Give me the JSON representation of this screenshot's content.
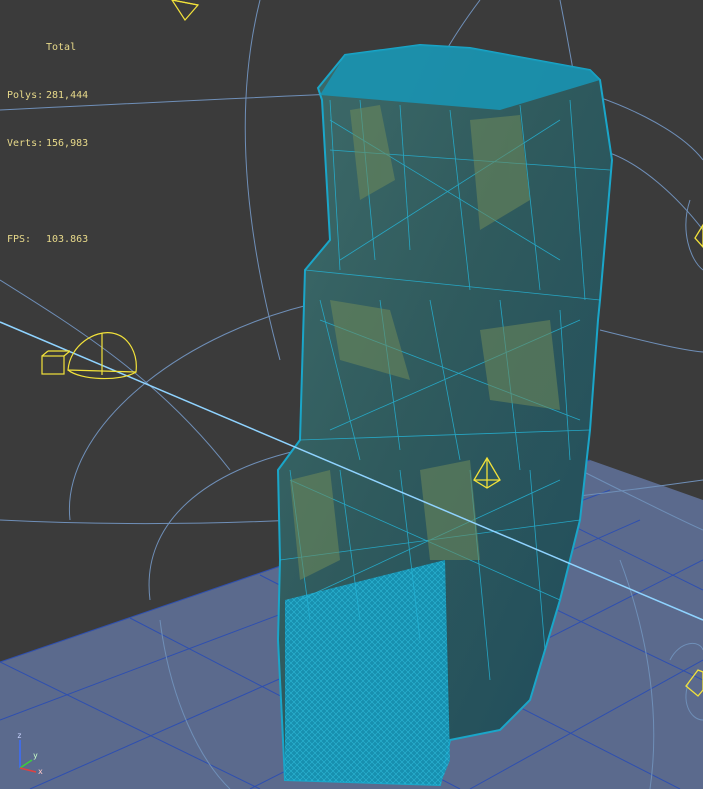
{
  "viewport": {
    "stats": {
      "header": "Total",
      "polys_label": "Polys:",
      "polys_value": "281,444",
      "verts_label": "Verts:",
      "verts_value": "156,983",
      "fps_label": "FPS:",
      "fps_value": "103.863"
    },
    "axis_gizmo": {
      "z_label": "z",
      "y_label": "y",
      "x_label": "x"
    },
    "colors": {
      "background": "#3b3b3b",
      "grid_plane": "#5b6a8d",
      "grid_lines": "#2e4fb0",
      "mesh_wire": "#1aa6c9",
      "helper_objects": "#f2e23a",
      "camera_lines": "#6f8fb8",
      "stats_text": "#e7d98a"
    }
  }
}
